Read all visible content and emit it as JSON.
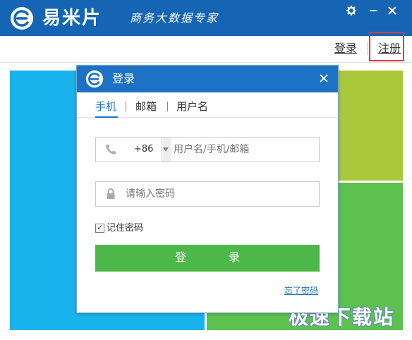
{
  "app": {
    "name": "易米片",
    "slogan": "商务大数据专家"
  },
  "header": {
    "login_link": "登录",
    "register_link": "注册"
  },
  "watermark": "极速下载站",
  "dialog": {
    "title": "登录",
    "tabs": [
      {
        "label": "手机",
        "active": true
      },
      {
        "label": "邮箱",
        "active": false
      },
      {
        "label": "用户名",
        "active": false
      }
    ],
    "country_code": "+86",
    "account_placeholder": "用户名/手机/邮箱",
    "password_placeholder": "请输入密码",
    "remember_label": "记住密码",
    "remember_checked": true,
    "login_button": "登录",
    "forgot_link": "忘了密码"
  },
  "colors": {
    "titlebar": "#1565b4",
    "dialog_title": "#1c72c4",
    "tile_blue": "#18b3ec",
    "tile_lime": "#a9c93a",
    "tile_green": "#5cc14e",
    "login_button": "#4db849",
    "register_highlight": "#e53935"
  },
  "icons": {
    "logo": "e-logo-icon",
    "settings": "gear-icon",
    "minimize": "minimize-icon",
    "close": "close-icon",
    "phone": "phone-icon",
    "password": "lock-icon"
  }
}
